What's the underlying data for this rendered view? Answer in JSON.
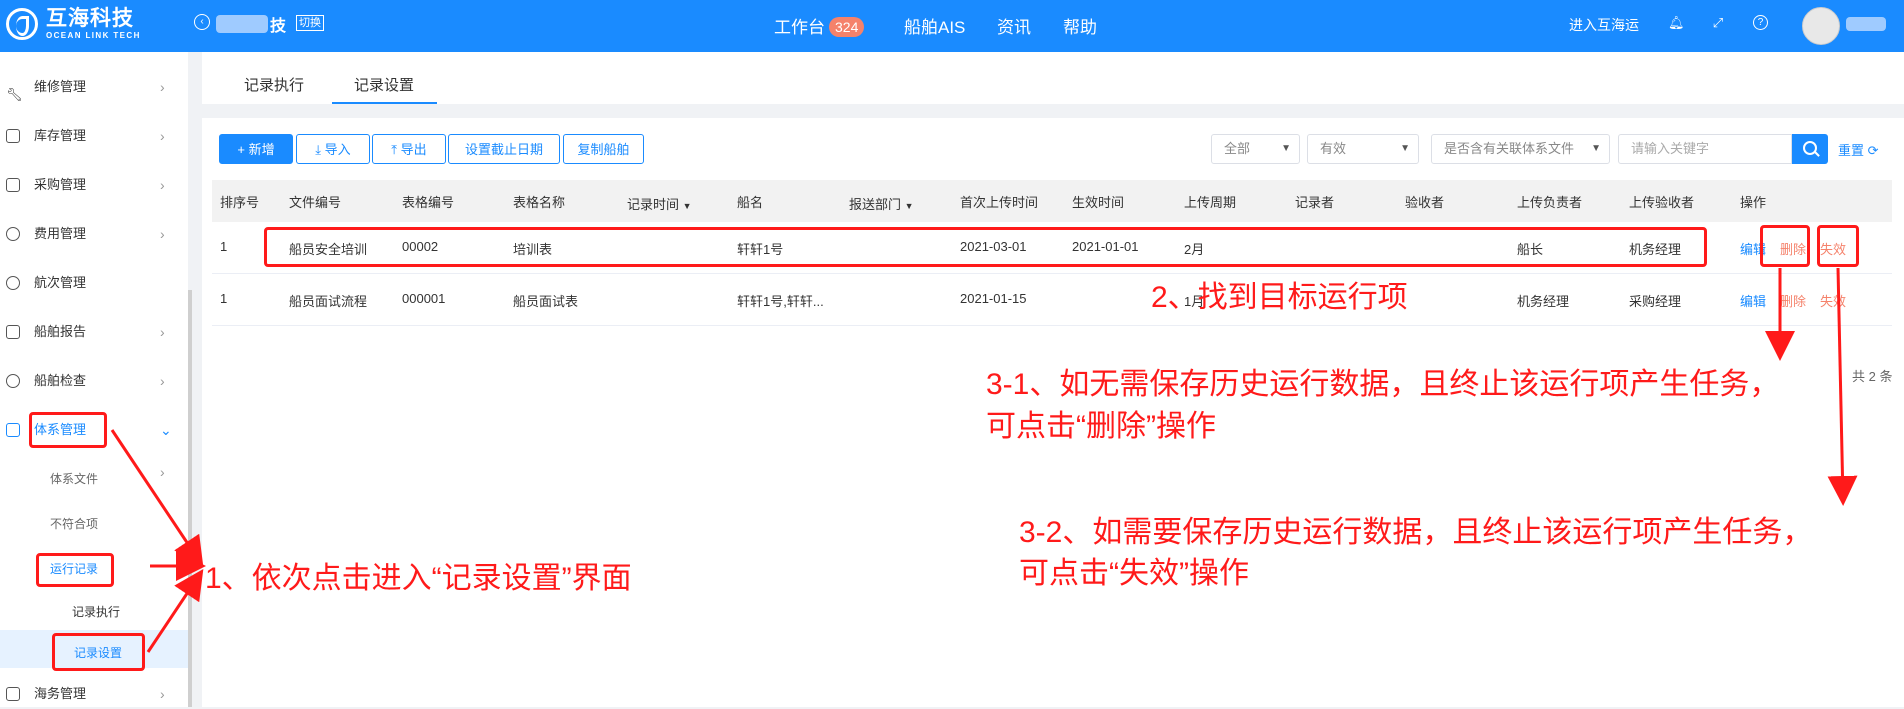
{
  "brand": {
    "name_cn": "互海科技",
    "name_en": "OCEAN LINK TECH"
  },
  "header": {
    "company": "技",
    "switch_label": "切换",
    "nav": [
      {
        "label": "工作台",
        "badge": "324"
      },
      {
        "label": "船舶AIS"
      },
      {
        "label": "资讯"
      },
      {
        "label": "帮助"
      }
    ],
    "enter_link": "进入互海运",
    "icons": [
      "bell-icon",
      "fullscreen-icon",
      "help-icon"
    ]
  },
  "sidebar": {
    "items": [
      {
        "label": "维修管理"
      },
      {
        "label": "库存管理"
      },
      {
        "label": "采购管理"
      },
      {
        "label": "费用管理"
      },
      {
        "label": "航次管理"
      },
      {
        "label": "船舶报告"
      },
      {
        "label": "船舶检查"
      },
      {
        "label": "体系管理"
      },
      {
        "label": "海务管理"
      }
    ],
    "sub_items": [
      {
        "label": "体系文件"
      },
      {
        "label": "不符合项"
      },
      {
        "label": "运行记录"
      }
    ],
    "leaf_items": [
      {
        "label": "记录执行"
      },
      {
        "label": "记录设置"
      }
    ]
  },
  "tabs": [
    {
      "label": "记录执行"
    },
    {
      "label": "记录设置"
    }
  ],
  "toolbar": {
    "add": "+ 新增",
    "import": "导入",
    "export": "导出",
    "set_deadline": "设置截止日期",
    "copy_ship": "复制船舶",
    "filter_all": "全部",
    "filter_valid": "有效",
    "filter_related": "是否含有关联体系文件",
    "search_placeholder": "请输入关键字",
    "reset": "重置"
  },
  "table": {
    "columns": [
      "排序号",
      "文件编号",
      "表格编号",
      "表格名称",
      "记录时间",
      "船名",
      "报送部门",
      "首次上传时间",
      "生效时间",
      "上传周期",
      "记录者",
      "验收者",
      "上传负责者",
      "上传验收者",
      "操作"
    ],
    "rows": [
      {
        "order": "1",
        "file_no": "船员安全培训",
        "form_no": "00002",
        "form_name": "培训表",
        "ship": "轩轩1号",
        "first_upload": "2021-03-01",
        "effective": "2021-01-01",
        "cycle": "2月",
        "uploader": "船长",
        "acceptor": "机务经理"
      },
      {
        "order": "1",
        "file_no": "船员面试流程",
        "form_no": "000001",
        "form_name": "船员面试表",
        "ship": "轩轩1号,轩轩...",
        "first_upload": "2021-01-15",
        "effective": "",
        "cycle": "1月",
        "uploader": "机务经理",
        "acceptor": "采购经理"
      }
    ],
    "actions": {
      "edit": "编辑",
      "delete": "删除",
      "invalidate": "失效"
    },
    "total": "共 2 条"
  },
  "annotations": {
    "step1": "1、依次点击进入“记录设置”界面",
    "step2": "2、找到目标运行项",
    "step3_1_line1": "3-1、如无需保存历史运行数据，且终止该运行项产生任务，",
    "step3_1_line2": "可点击“删除”操作",
    "step3_2_line1": "3-2、如需要保存历史运行数据，且终止该运行项产生任务，",
    "step3_2_line2": "可点击“失效”操作"
  },
  "colors": {
    "primary": "#1a8bff",
    "annotation": "#ff1a1a",
    "badge": "#f5826b"
  }
}
